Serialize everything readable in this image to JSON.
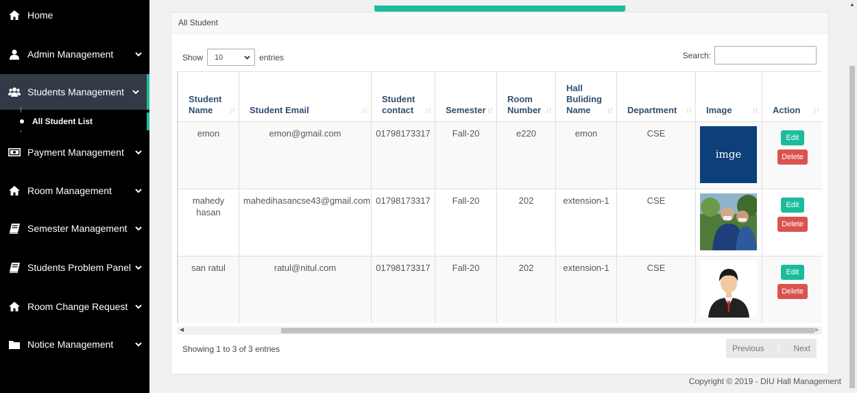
{
  "sidebar": {
    "items": [
      {
        "label": "Home",
        "icon": "home-icon",
        "chevron": false
      },
      {
        "label": "Admin Management",
        "icon": "user-icon",
        "chevron": true
      },
      {
        "label": "Students Management",
        "icon": "users-icon",
        "chevron": true,
        "active": true
      },
      {
        "label": "Payment Management",
        "icon": "money-icon",
        "chevron": true
      },
      {
        "label": "Room Management",
        "icon": "home-icon",
        "chevron": true
      },
      {
        "label": "Semester Management",
        "icon": "book-icon",
        "chevron": true
      },
      {
        "label": "Students Problem Panel",
        "icon": "book-icon",
        "chevron": true
      },
      {
        "label": "Room Change Request",
        "icon": "home-icon",
        "chevron": true
      },
      {
        "label": "Notice Management",
        "icon": "folder-icon",
        "chevron": true
      }
    ],
    "sub_item": "All Student List"
  },
  "panel": {
    "title": "All Student",
    "show_label": "Show",
    "entries_value": "10",
    "entries_label": "entries",
    "search_label": "Search:",
    "search_value": "",
    "info": "Showing 1 to 3 of 3 entries",
    "prev": "Previous",
    "page": "1",
    "next": "Next"
  },
  "table": {
    "headers": [
      "Student Name",
      "Student Email",
      "Student contact",
      "Semester",
      "Room Number",
      "Hall Buliding Name",
      "Department",
      "Image",
      "Action"
    ],
    "rows": [
      {
        "name": "emon",
        "email": "emon@gmail.com",
        "contact": "01798173317",
        "semester": "Fall-20",
        "room": "e220",
        "hall": "emon",
        "dept": "CSE",
        "image_text": "imge",
        "edit": "Edit",
        "delete": "Delete"
      },
      {
        "name": "mahedy hasan",
        "email": "mahedihasancse43@gmail.com",
        "contact": "01798173317",
        "semester": "Fall-20",
        "room": "202",
        "hall": "extension-1",
        "dept": "CSE",
        "edit": "Edit",
        "delete": "Delete"
      },
      {
        "name": "san ratul",
        "email": "ratul@nitul.com",
        "contact": "01798173317",
        "semester": "Fall-20",
        "room": "202",
        "hall": "extension-1",
        "dept": "CSE",
        "edit": "Edit",
        "delete": "Delete"
      }
    ]
  },
  "footer": "Copyright © 2019 - DIU Hall Management",
  "colors": {
    "accent": "#1abc9c",
    "danger": "#d9534f",
    "sidebar": "#000000"
  }
}
